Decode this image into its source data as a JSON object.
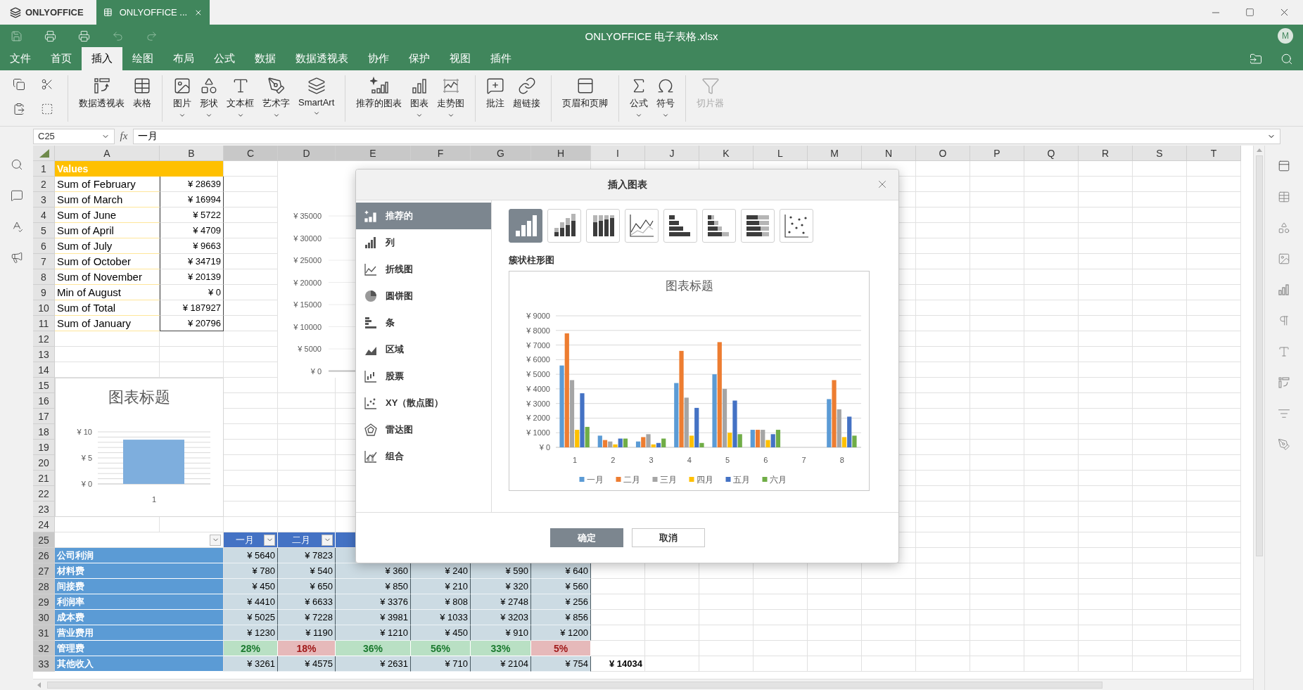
{
  "titlebar": {
    "brand": "ONLYOFFICE",
    "tabs": [
      {
        "label": "ONLYOFFICE ...",
        "selected": true
      }
    ]
  },
  "header": {
    "title": "ONLYOFFICE 电子表格.xlsx",
    "avatar": "M"
  },
  "menu": [
    {
      "label": "文件",
      "selected": false
    },
    {
      "label": "首页",
      "selected": false
    },
    {
      "label": "插入",
      "selected": true
    },
    {
      "label": "绘图",
      "selected": false
    },
    {
      "label": "布局",
      "selected": false
    },
    {
      "label": "公式",
      "selected": false
    },
    {
      "label": "数据",
      "selected": false
    },
    {
      "label": "数据透视表",
      "selected": false
    },
    {
      "label": "协作",
      "selected": false
    },
    {
      "label": "保护",
      "selected": false
    },
    {
      "label": "视图",
      "selected": false
    },
    {
      "label": "插件",
      "selected": false
    }
  ],
  "toolbar": {
    "groups": [
      [
        {
          "label": "数据透视表",
          "dropdown": false,
          "disabled": false
        },
        {
          "label": "表格",
          "dropdown": false,
          "disabled": false
        }
      ],
      [
        {
          "label": "图片",
          "dropdown": true,
          "disabled": false
        },
        {
          "label": "形状",
          "dropdown": true,
          "disabled": false
        },
        {
          "label": "文本框",
          "dropdown": true,
          "disabled": false
        },
        {
          "label": "艺术字",
          "dropdown": true,
          "disabled": false
        },
        {
          "label": "SmartArt",
          "dropdown": true,
          "disabled": false
        }
      ],
      [
        {
          "label": "推荐的图表",
          "dropdown": false,
          "disabled": false
        },
        {
          "label": "图表",
          "dropdown": true,
          "disabled": false
        },
        {
          "label": "走势图",
          "dropdown": true,
          "disabled": false
        }
      ],
      [
        {
          "label": "批注",
          "dropdown": false,
          "disabled": false
        },
        {
          "label": "超链接",
          "dropdown": false,
          "disabled": false
        }
      ],
      [
        {
          "label": "页眉和页脚",
          "dropdown": false,
          "disabled": false
        }
      ],
      [
        {
          "label": "公式",
          "dropdown": true,
          "disabled": false
        },
        {
          "label": "符号",
          "dropdown": true,
          "disabled": false
        }
      ],
      [
        {
          "label": "切片器",
          "dropdown": false,
          "disabled": true
        }
      ]
    ]
  },
  "formula_bar": {
    "cell": "C25",
    "fx": "fx",
    "value": "一月"
  },
  "sheet": {
    "columns": [
      {
        "label": "A",
        "selected": false
      },
      {
        "label": "B",
        "selected": false
      },
      {
        "label": "C",
        "selected": true
      },
      {
        "label": "D",
        "selected": true
      },
      {
        "label": "E",
        "selected": true
      },
      {
        "label": "F",
        "selected": true
      },
      {
        "label": "G",
        "selected": true
      },
      {
        "label": "H",
        "selected": true
      },
      {
        "label": "I",
        "selected": false
      },
      {
        "label": "J",
        "selected": false
      },
      {
        "label": "K",
        "selected": false
      },
      {
        "label": "L",
        "selected": false
      },
      {
        "label": "M",
        "selected": false
      },
      {
        "label": "N",
        "selected": false
      },
      {
        "label": "O",
        "selected": false
      },
      {
        "label": "P",
        "selected": false
      },
      {
        "label": "Q",
        "selected": false
      },
      {
        "label": "R",
        "selected": false
      },
      {
        "label": "S",
        "selected": false
      },
      {
        "label": "T",
        "selected": false
      }
    ],
    "rows": [
      {
        "number": "1",
        "selected": false,
        "kind": "header",
        "label": "Values"
      },
      {
        "number": "2",
        "selected": false,
        "kind": "value",
        "label": "Sum of February",
        "value": "¥ 28639"
      },
      {
        "number": "3",
        "selected": false,
        "kind": "value",
        "label": "Sum of March",
        "value": "¥ 16994"
      },
      {
        "number": "4",
        "selected": false,
        "kind": "value",
        "label": "Sum of June",
        "value": "¥ 5722"
      },
      {
        "number": "5",
        "selected": false,
        "kind": "value",
        "label": "Sum of April",
        "value": "¥ 4709"
      },
      {
        "number": "6",
        "selected": false,
        "kind": "value",
        "label": "Sum of July",
        "value": "¥ 9663"
      },
      {
        "number": "7",
        "selected": false,
        "kind": "value",
        "label": "Sum of October",
        "value": "¥ 34719"
      },
      {
        "number": "8",
        "selected": false,
        "kind": "value",
        "label": "Sum of November",
        "value": "¥ 20139"
      },
      {
        "number": "9",
        "selected": false,
        "kind": "value",
        "label": "Min of August",
        "value": "¥ 0"
      },
      {
        "number": "10",
        "selected": false,
        "kind": "value",
        "label": "Sum of Total",
        "value": "¥ 187927"
      },
      {
        "number": "11",
        "selected": false,
        "kind": "value",
        "label": "Sum of January",
        "value": "¥ 20796"
      },
      {
        "number": "12",
        "selected": false,
        "kind": "empty"
      },
      {
        "number": "13",
        "selected": false,
        "kind": "empty"
      },
      {
        "number": "14",
        "selected": false,
        "kind": "empty"
      },
      {
        "number": "15",
        "selected": false,
        "kind": "empty"
      },
      {
        "number": "16",
        "selected": false,
        "kind": "empty"
      },
      {
        "number": "17",
        "selected": false,
        "kind": "empty"
      },
      {
        "number": "18",
        "selected": false,
        "kind": "empty"
      },
      {
        "number": "19",
        "selected": false,
        "kind": "empty"
      },
      {
        "number": "20",
        "selected": false,
        "kind": "empty"
      },
      {
        "number": "21",
        "selected": false,
        "kind": "empty"
      },
      {
        "number": "22",
        "selected": false,
        "kind": "empty"
      },
      {
        "number": "23",
        "selected": false,
        "kind": "empty"
      },
      {
        "number": "24",
        "selected": false,
        "kind": "empty"
      },
      {
        "number": "25",
        "selected": true,
        "kind": "table_header",
        "headers": [
          "一月",
          "二月"
        ]
      },
      {
        "number": "26",
        "selected": true,
        "kind": "data",
        "label": "公司利润",
        "values": [
          "¥ 5640",
          "¥ 7823"
        ]
      },
      {
        "number": "27",
        "selected": true,
        "kind": "data",
        "label": "材料费",
        "values": [
          "¥ 780",
          "¥ 540",
          "¥ 360",
          "¥ 240",
          "¥ 590",
          "¥ 640"
        ]
      },
      {
        "number": "28",
        "selected": true,
        "kind": "data",
        "label": "间接费",
        "values": [
          "¥ 450",
          "¥ 650",
          "¥ 850",
          "¥ 210",
          "¥ 320",
          "¥ 560"
        ]
      },
      {
        "number": "29",
        "selected": true,
        "kind": "data",
        "label": "利润率",
        "values": [
          "¥ 4410",
          "¥ 6633",
          "¥ 3376",
          "¥ 808",
          "¥ 2748",
          "¥ 256"
        ]
      },
      {
        "number": "30",
        "selected": true,
        "kind": "data",
        "label": "成本费",
        "values": [
          "¥ 5025",
          "¥ 7228",
          "¥ 3981",
          "¥ 1033",
          "¥ 3203",
          "¥ 856"
        ]
      },
      {
        "number": "31",
        "selected": true,
        "kind": "data",
        "label": "营业费用",
        "values": [
          "¥ 1230",
          "¥ 1190",
          "¥ 1210",
          "¥ 450",
          "¥ 910",
          "¥ 1200"
        ]
      },
      {
        "number": "32",
        "selected": true,
        "kind": "percent",
        "label": "管理费",
        "values": [
          {
            "text": "28%",
            "positive": true
          },
          {
            "text": "18%",
            "positive": false
          },
          {
            "text": "36%",
            "positive": true
          },
          {
            "text": "56%",
            "positive": true
          },
          {
            "text": "33%",
            "positive": true
          },
          {
            "text": "5%",
            "positive": false
          }
        ]
      },
      {
        "number": "33",
        "selected": true,
        "kind": "data",
        "label": "其他收入",
        "values": [
          "¥ 3261",
          "¥ 4575",
          "¥ 2631",
          "¥ 710",
          "¥ 2104",
          "¥ 754"
        ],
        "total": "¥ 14034"
      }
    ],
    "chart": {
      "chart_data": {
        "type": "bar",
        "grid": true,
        "title": "图表标题",
        "categories": [
          "1"
        ],
        "series": [
          {
            "color": "#7eaedd",
            "values": [
              8.5
            ]
          }
        ],
        "ylim": [
          0,
          10
        ],
        "yticks": [
          {
            "value": 0,
            "label": "¥ 0"
          },
          {
            "value": 5,
            "label": "¥ 5"
          },
          {
            "value": 10,
            "label": "¥ 10"
          }
        ]
      }
    },
    "partial_chart": {
      "y_labels": [
        "¥ 35000",
        "¥ 30000",
        "¥ 25000",
        "¥ 20000",
        "¥ 15000",
        "¥ 10000",
        "¥ 5000",
        "¥ 0"
      ]
    }
  },
  "dialog": {
    "title": "插入图表",
    "categories": [
      {
        "label": "推荐的",
        "selected": true
      },
      {
        "label": "列",
        "selected": false
      },
      {
        "label": "折线图",
        "selected": false
      },
      {
        "label": "圆饼图",
        "selected": false
      },
      {
        "label": "条",
        "selected": false
      },
      {
        "label": "区域",
        "selected": false
      },
      {
        "label": "股票",
        "selected": false
      },
      {
        "label": "XY（散点图）",
        "selected": false
      },
      {
        "label": "雷达图",
        "selected": false
      },
      {
        "label": "组合",
        "selected": false
      }
    ],
    "chart_types": [
      {
        "selected": true
      },
      {
        "selected": false
      },
      {
        "selected": false
      },
      {
        "selected": false
      },
      {
        "selected": false
      },
      {
        "selected": false
      },
      {
        "selected": false
      },
      {
        "selected": false
      }
    ],
    "type_name": "簇状柱形图",
    "preview": {
      "chart_data": {
        "type": "bar",
        "grid": true,
        "legend": "bottom",
        "title": "图表标题",
        "categories": [
          "1",
          "2",
          "3",
          "4",
          "5",
          "6",
          "7",
          "8"
        ],
        "ylim": [
          0,
          9000
        ],
        "yticks": [
          {
            "value": 0,
            "label": "¥ 0"
          },
          {
            "value": 1000,
            "label": "¥ 1000"
          },
          {
            "value": 2000,
            "label": "¥ 2000"
          },
          {
            "value": 3000,
            "label": "¥ 3000"
          },
          {
            "value": 4000,
            "label": "¥ 4000"
          },
          {
            "value": 5000,
            "label": "¥ 5000"
          },
          {
            "value": 6000,
            "label": "¥ 6000"
          },
          {
            "value": 7000,
            "label": "¥ 7000"
          },
          {
            "value": 8000,
            "label": "¥ 8000"
          },
          {
            "value": 9000,
            "label": "¥ 9000"
          }
        ],
        "series": [
          {
            "name": "一月",
            "color": "#5b9bd5",
            "values": [
              5600,
              800,
              400,
              4400,
              5000,
              1200,
              0,
              3300
            ]
          },
          {
            "name": "二月",
            "color": "#ed7d31",
            "values": [
              7800,
              500,
              700,
              6600,
              7200,
              1200,
              0,
              4600
            ]
          },
          {
            "name": "三月",
            "color": "#a5a5a5",
            "values": [
              4600,
              400,
              900,
              3400,
              4000,
              1200,
              0,
              2600
            ]
          },
          {
            "name": "四月",
            "color": "#ffc000",
            "values": [
              1200,
              200,
              200,
              800,
              1000,
              500,
              0,
              700
            ]
          },
          {
            "name": "五月",
            "color": "#4472c4",
            "values": [
              3700,
              600,
              300,
              2700,
              3200,
              900,
              0,
              2100
            ]
          },
          {
            "name": "六月",
            "color": "#70ad47",
            "values": [
              1400,
              600,
              600,
              300,
              900,
              1200,
              0,
              800
            ]
          }
        ]
      }
    },
    "buttons": [
      {
        "label": "确定",
        "kind": "primary"
      },
      {
        "label": "取消",
        "kind": "secondary"
      }
    ]
  }
}
